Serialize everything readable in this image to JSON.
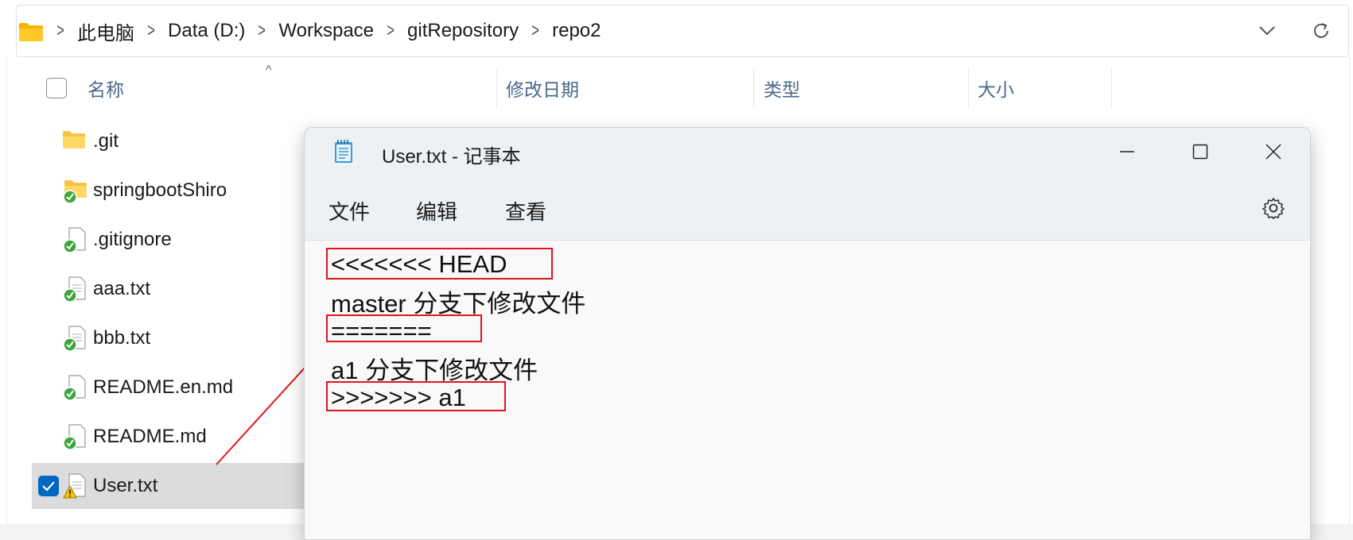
{
  "breadcrumb": {
    "items": [
      "此电脑",
      "Data (D:)",
      "Workspace",
      "gitRepository",
      "repo2"
    ]
  },
  "columns": {
    "name": "名称",
    "modified": "修改日期",
    "type": "类型",
    "size": "大小"
  },
  "files": [
    {
      "name": ".git",
      "icon": "folder-icon"
    },
    {
      "name": "springbootShiro",
      "icon": "folder-synced-icon"
    },
    {
      "name": ".gitignore",
      "icon": "file-synced-icon"
    },
    {
      "name": "aaa.txt",
      "icon": "file-synced-icon"
    },
    {
      "name": "bbb.txt",
      "icon": "file-synced-icon"
    },
    {
      "name": "README.en.md",
      "icon": "file-synced-icon"
    },
    {
      "name": "README.md",
      "icon": "file-synced-icon"
    },
    {
      "name": "User.txt",
      "icon": "file-conflict-icon",
      "selected": true
    }
  ],
  "notepad": {
    "title": "User.txt - 记事本",
    "menu": [
      "文件",
      "编辑",
      "查看"
    ],
    "lines": [
      "<<<<<<< HEAD",
      "master 分支下修改文件",
      "=======",
      "a1 分支下修改文件",
      ">>>>>>> a1"
    ]
  },
  "colors": {
    "accent": "#0067c0",
    "highlight_box": "#e0141e",
    "sync_ok": "#3aa63a",
    "warning": "#f5c400"
  }
}
